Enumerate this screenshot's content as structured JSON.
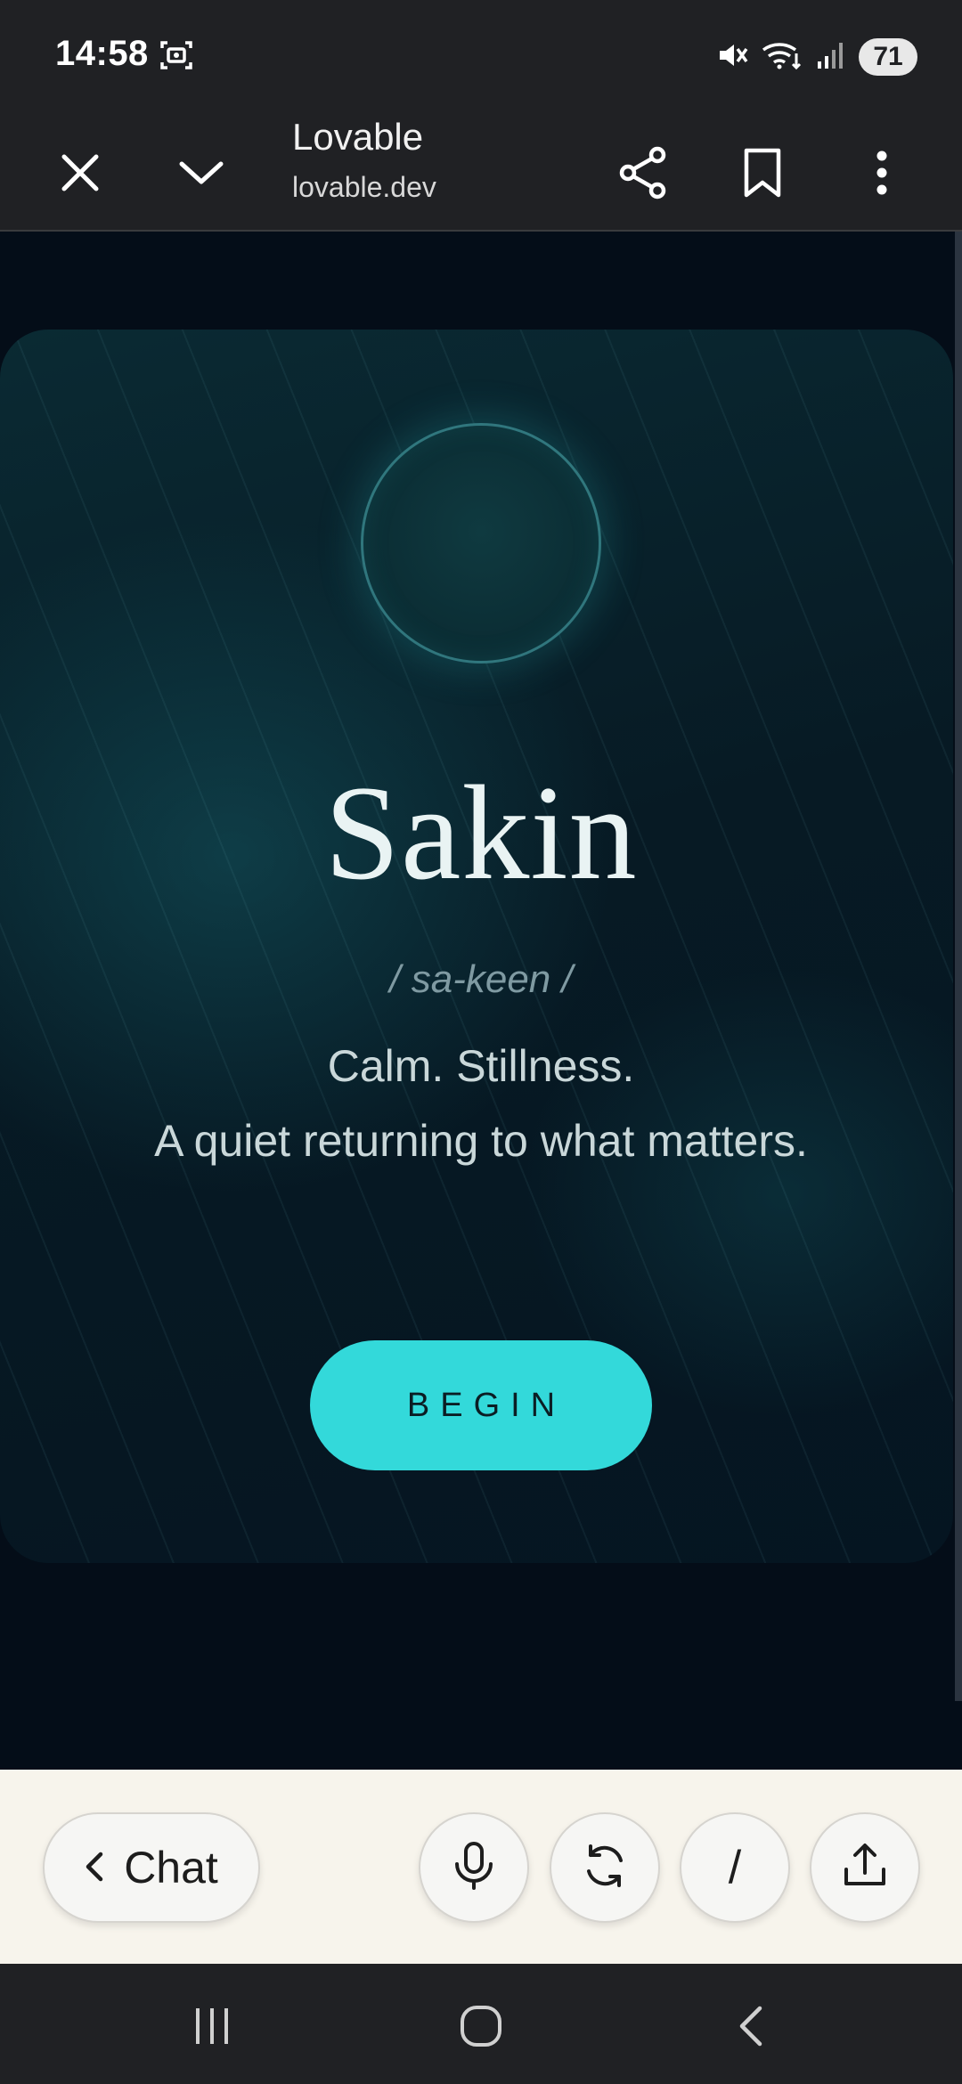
{
  "status_bar": {
    "time": "14:58",
    "battery": "71",
    "icons": [
      "screenshot-icon",
      "mute-icon",
      "wifi-icon",
      "signal-icon",
      "battery-icon"
    ]
  },
  "browser": {
    "title": "Lovable",
    "url": "lovable.dev",
    "icons": [
      "close-icon",
      "chevron-down-icon",
      "share-icon",
      "bookmark-icon",
      "more-vert-icon"
    ]
  },
  "hero": {
    "title": "Sakin",
    "phonetic": "/ sa-keen /",
    "line1": "Calm. Stillness.",
    "line2": "A quiet returning to what matters.",
    "button": "BEGIN"
  },
  "app_bar": {
    "chat_label": "Chat",
    "slash_label": "/",
    "icons": [
      "chevron-left-icon",
      "mic-icon",
      "refresh-icon",
      "upload-icon"
    ]
  },
  "nav": {
    "icons": [
      "recents-icon",
      "home-icon",
      "back-icon"
    ]
  },
  "colors": {
    "accent": "#33d9da",
    "page_bg": "#040d18",
    "chrome_bg": "#202124",
    "app_bar_bg": "#f7f4ec"
  }
}
